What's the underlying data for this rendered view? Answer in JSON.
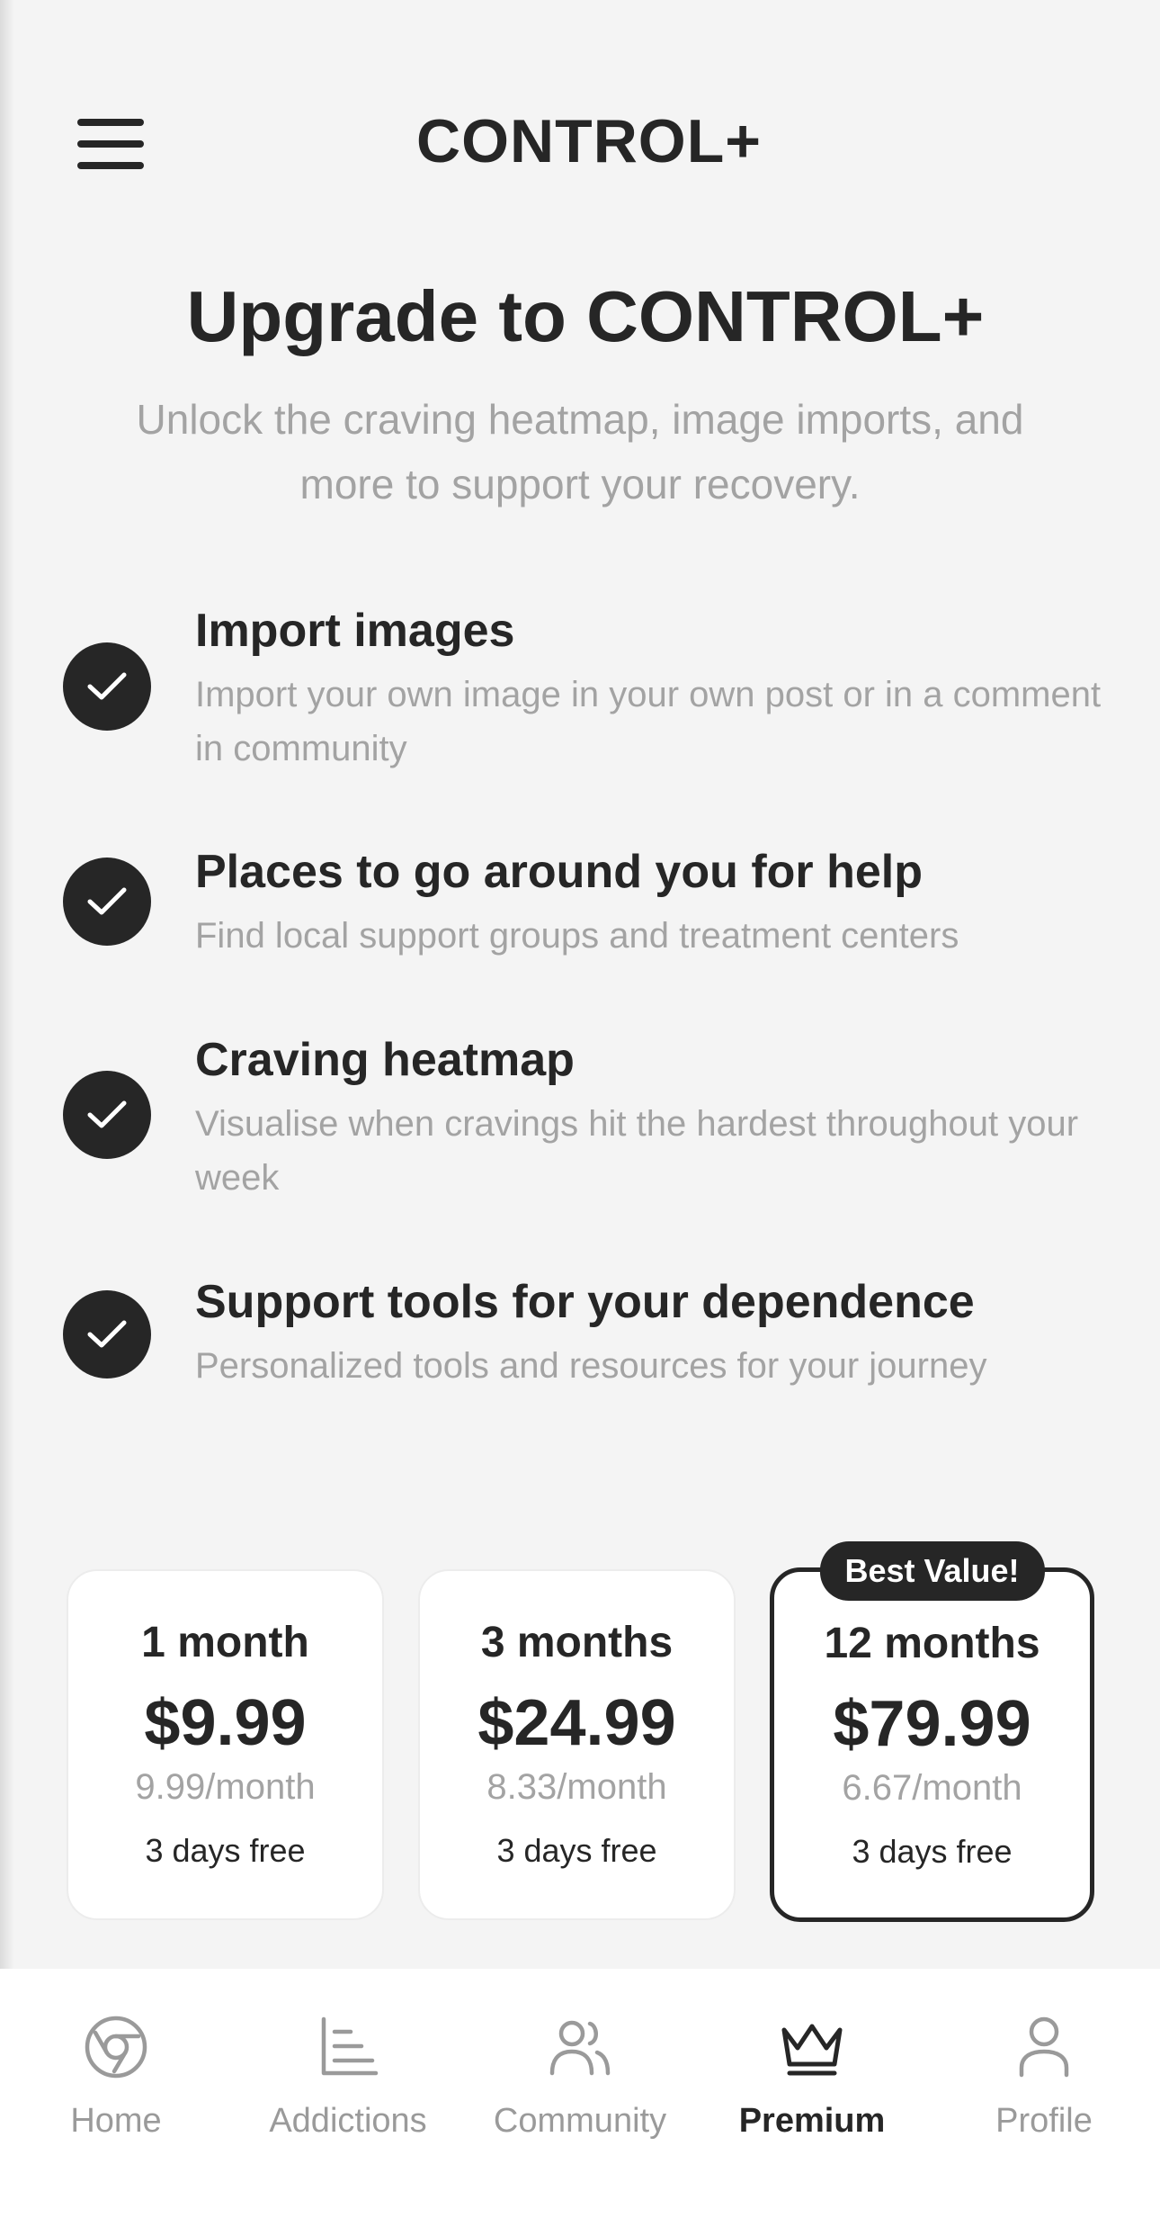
{
  "header": {
    "title": "CONTROL+",
    "menu_icon": "hamburger-menu-icon"
  },
  "hero": {
    "title": "Upgrade to CONTROL+",
    "subtitle": "Unlock the craving heatmap, image imports, and more to support your recovery."
  },
  "features": [
    {
      "title": "Import images",
      "description": "Import your own image in your own post or in a comment in community",
      "icon": "check-circle-icon"
    },
    {
      "title": "Places to go around you for help",
      "description": "Find local support groups and treatment centers",
      "icon": "check-circle-icon"
    },
    {
      "title": "Craving heatmap",
      "description": "Visualise when cravings hit the hardest throughout your week",
      "icon": "check-circle-icon"
    },
    {
      "title": "Support tools for your dependence",
      "description": "Personalized tools and resources for your journey",
      "icon": "check-circle-icon"
    }
  ],
  "plans": [
    {
      "name": "1 month",
      "price": "$9.99",
      "per_month": "9.99/month",
      "trial": "3 days free",
      "selected": false
    },
    {
      "name": "3 months",
      "price": "$24.99",
      "per_month": "8.33/month",
      "trial": "3 days free",
      "selected": false
    },
    {
      "name": "12 months",
      "price": "$79.99",
      "per_month": "6.67/month",
      "trial": "3 days free",
      "selected": true,
      "badge": "Best Value!"
    }
  ],
  "tabbar": {
    "items": [
      {
        "label": "Home",
        "icon": "home-circle-icon",
        "active": false
      },
      {
        "label": "Addictions",
        "icon": "chart-icon",
        "active": false
      },
      {
        "label": "Community",
        "icon": "people-icon",
        "active": false
      },
      {
        "label": "Premium",
        "icon": "crown-icon",
        "active": true
      },
      {
        "label": "Profile",
        "icon": "person-icon",
        "active": false
      }
    ]
  },
  "colors": {
    "background": "#f4f4f4",
    "primary": "#262626",
    "muted_text": "#a3a3a3",
    "card": "#ffffff"
  }
}
